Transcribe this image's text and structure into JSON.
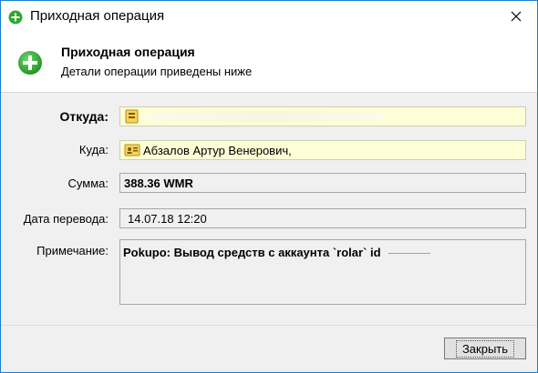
{
  "window": {
    "title": "Приходная операция",
    "icon": "plus-circle-icon"
  },
  "header": {
    "title": "Приходная операция",
    "subtitle": "Детали операции приведены ниже",
    "icon": "plus-circle-icon",
    "accent": "#2fa82f"
  },
  "form": {
    "from_label": "Откуда:",
    "from_value": "",
    "to_label": "Куда:",
    "to_value": "Абзалов Артур Венерович,",
    "amount_label": "Сумма:",
    "amount_value": "388.36 WMR",
    "date_label": "Дата перевода:",
    "date_value": "14.07.18 12:20",
    "note_label": "Примечание:",
    "note_value": "Pokupo: Вывод средств с аккаунта `rolar` id"
  },
  "footer": {
    "close_label": "Закрыть"
  },
  "colors": {
    "field_yellow": "#fdfdd6",
    "border": "#a7a7a7",
    "window_border": "#1a7fd4"
  }
}
